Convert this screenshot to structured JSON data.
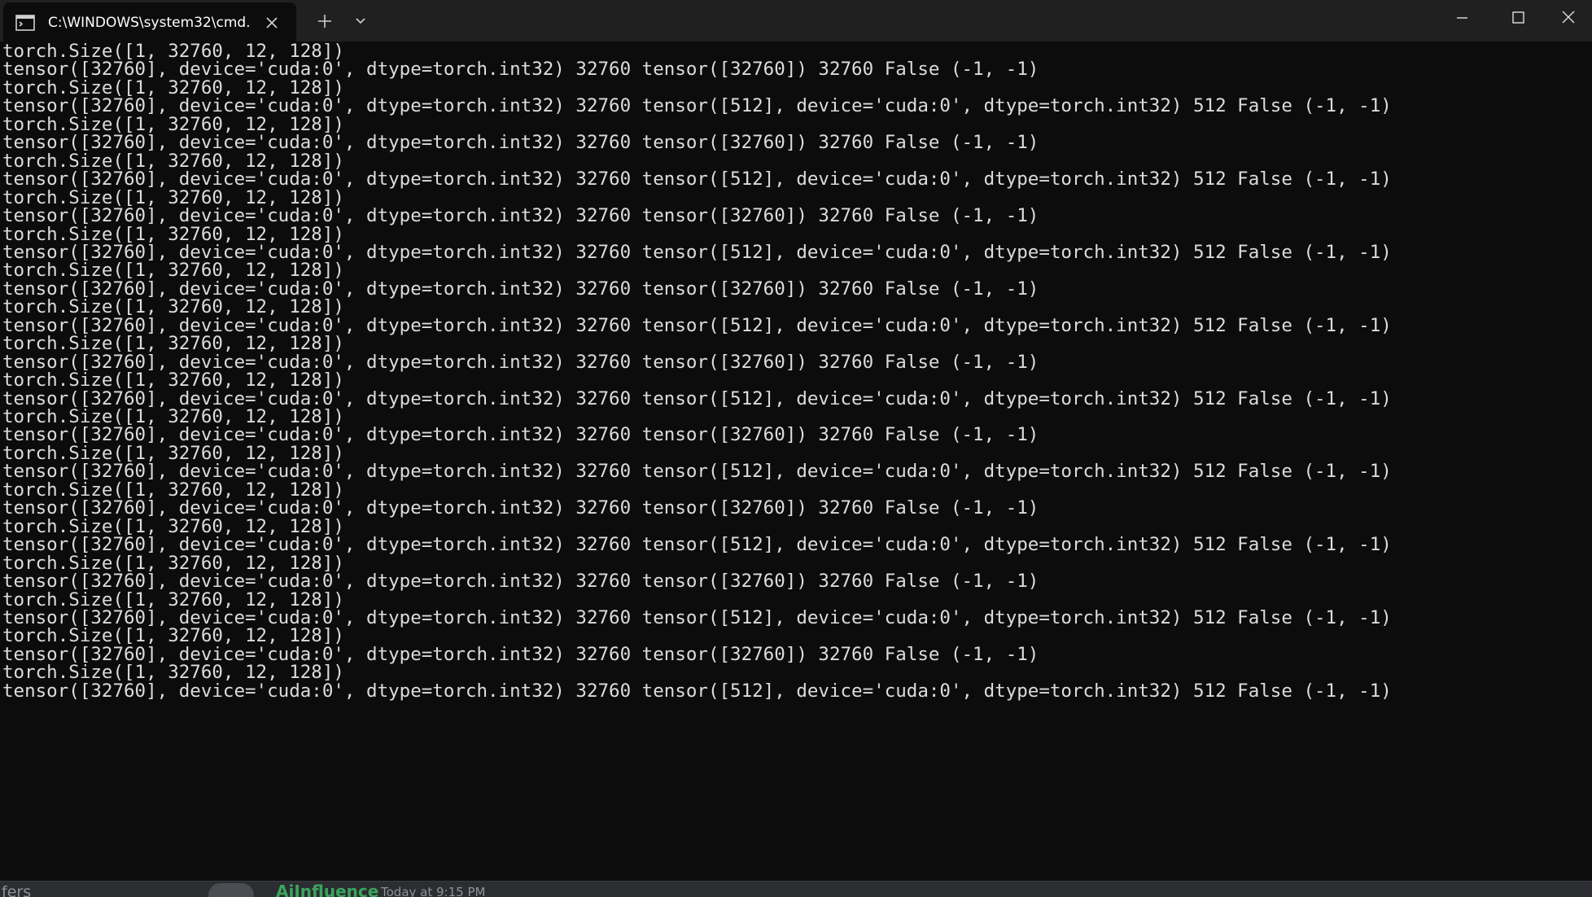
{
  "window": {
    "tab_title": "C:\\WINDOWS\\system32\\cmd.",
    "colors": {
      "titlebar": "#202020",
      "console_background": "#0c0c0c",
      "console_text": "#dcdcdc"
    },
    "icons": {
      "tab_icon": "terminal-icon",
      "tab_close": "close-icon",
      "new_tab": "plus-icon",
      "dropdown": "chevron-down-icon",
      "minimize": "minimize-icon",
      "maximize": "maximize-icon",
      "close": "close-icon"
    }
  },
  "console": {
    "lines": [
      "torch.Size([1, 32760, 12, 128])",
      "tensor([32760], device='cuda:0', dtype=torch.int32) 32760 tensor([32760]) 32760 False (-1, -1)",
      "torch.Size([1, 32760, 12, 128])",
      "tensor([32760], device='cuda:0', dtype=torch.int32) 32760 tensor([512], device='cuda:0', dtype=torch.int32) 512 False (-1, -1)",
      "torch.Size([1, 32760, 12, 128])",
      "tensor([32760], device='cuda:0', dtype=torch.int32) 32760 tensor([32760]) 32760 False (-1, -1)",
      "torch.Size([1, 32760, 12, 128])",
      "tensor([32760], device='cuda:0', dtype=torch.int32) 32760 tensor([512], device='cuda:0', dtype=torch.int32) 512 False (-1, -1)",
      "torch.Size([1, 32760, 12, 128])",
      "tensor([32760], device='cuda:0', dtype=torch.int32) 32760 tensor([32760]) 32760 False (-1, -1)",
      "torch.Size([1, 32760, 12, 128])",
      "tensor([32760], device='cuda:0', dtype=torch.int32) 32760 tensor([512], device='cuda:0', dtype=torch.int32) 512 False (-1, -1)",
      "torch.Size([1, 32760, 12, 128])",
      "tensor([32760], device='cuda:0', dtype=torch.int32) 32760 tensor([32760]) 32760 False (-1, -1)",
      "torch.Size([1, 32760, 12, 128])",
      "tensor([32760], device='cuda:0', dtype=torch.int32) 32760 tensor([512], device='cuda:0', dtype=torch.int32) 512 False (-1, -1)",
      "torch.Size([1, 32760, 12, 128])",
      "tensor([32760], device='cuda:0', dtype=torch.int32) 32760 tensor([32760]) 32760 False (-1, -1)",
      "torch.Size([1, 32760, 12, 128])",
      "tensor([32760], device='cuda:0', dtype=torch.int32) 32760 tensor([512], device='cuda:0', dtype=torch.int32) 512 False (-1, -1)",
      "torch.Size([1, 32760, 12, 128])",
      "tensor([32760], device='cuda:0', dtype=torch.int32) 32760 tensor([32760]) 32760 False (-1, -1)",
      "torch.Size([1, 32760, 12, 128])",
      "tensor([32760], device='cuda:0', dtype=torch.int32) 32760 tensor([512], device='cuda:0', dtype=torch.int32) 512 False (-1, -1)",
      "torch.Size([1, 32760, 12, 128])",
      "tensor([32760], device='cuda:0', dtype=torch.int32) 32760 tensor([32760]) 32760 False (-1, -1)",
      "torch.Size([1, 32760, 12, 128])",
      "tensor([32760], device='cuda:0', dtype=torch.int32) 32760 tensor([512], device='cuda:0', dtype=torch.int32) 512 False (-1, -1)",
      "torch.Size([1, 32760, 12, 128])",
      "tensor([32760], device='cuda:0', dtype=torch.int32) 32760 tensor([32760]) 32760 False (-1, -1)",
      "torch.Size([1, 32760, 12, 128])",
      "tensor([32760], device='cuda:0', dtype=torch.int32) 32760 tensor([512], device='cuda:0', dtype=torch.int32) 512 False (-1, -1)",
      "torch.Size([1, 32760, 12, 128])",
      "tensor([32760], device='cuda:0', dtype=torch.int32) 32760 tensor([32760]) 32760 False (-1, -1)",
      "torch.Size([1, 32760, 12, 128])",
      "tensor([32760], device='cuda:0', dtype=torch.int32) 32760 tensor([512], device='cuda:0', dtype=torch.int32) 512 False (-1, -1)"
    ]
  },
  "background_app": {
    "left_text": "fers",
    "username": "AiInfluence",
    "timestamp": "Today at 9:15 PM"
  }
}
